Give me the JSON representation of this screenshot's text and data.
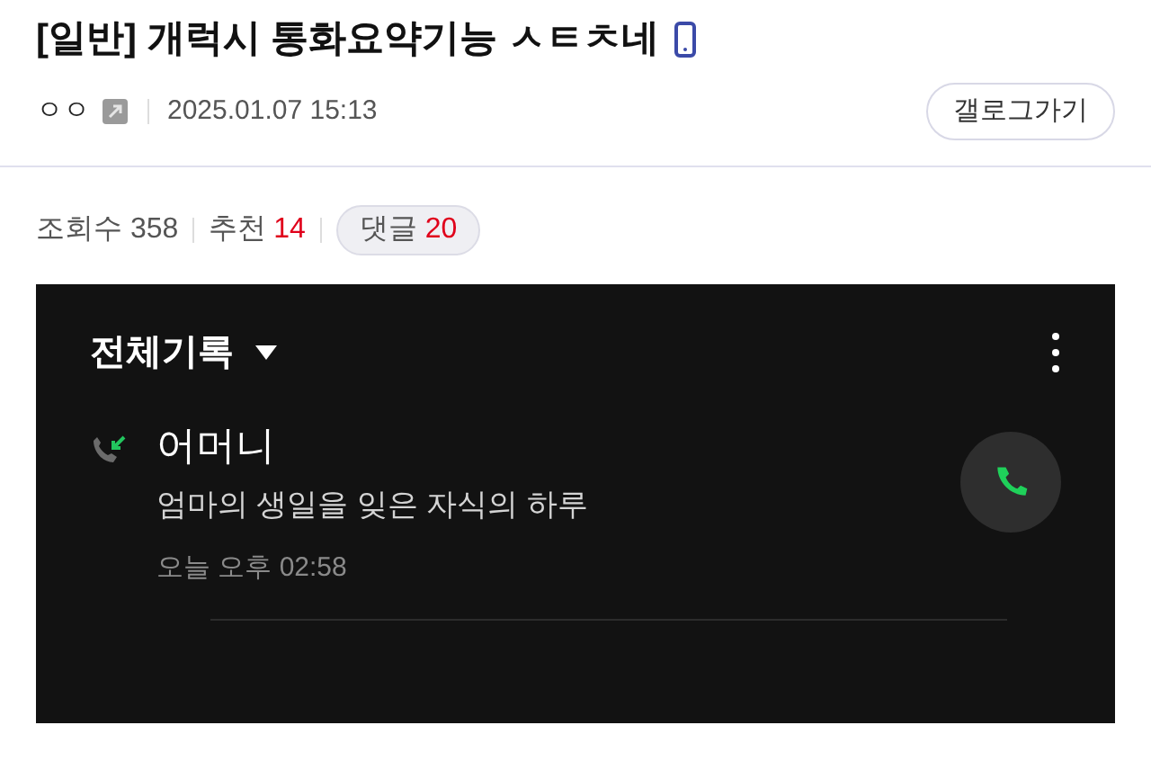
{
  "post": {
    "category": "[일반]",
    "title": "개럭시 통화요약기능 ㅅㅌㅊ네",
    "mobile": true,
    "author": "ㅇㅇ",
    "date": "2025.01.07 15:13",
    "gallog_button": "갤로그가기"
  },
  "stats": {
    "views_label": "조회수",
    "views": "358",
    "likes_label": "추천",
    "likes": "14",
    "comments_label": "댓글",
    "comments": "20"
  },
  "screenshot": {
    "filter": "전체기록",
    "calls": [
      {
        "name": "어머니",
        "summary": "엄마의 생일을 잊은 자식의 하루",
        "time": "오늘 오후 02:58",
        "kind": "incoming"
      }
    ]
  }
}
